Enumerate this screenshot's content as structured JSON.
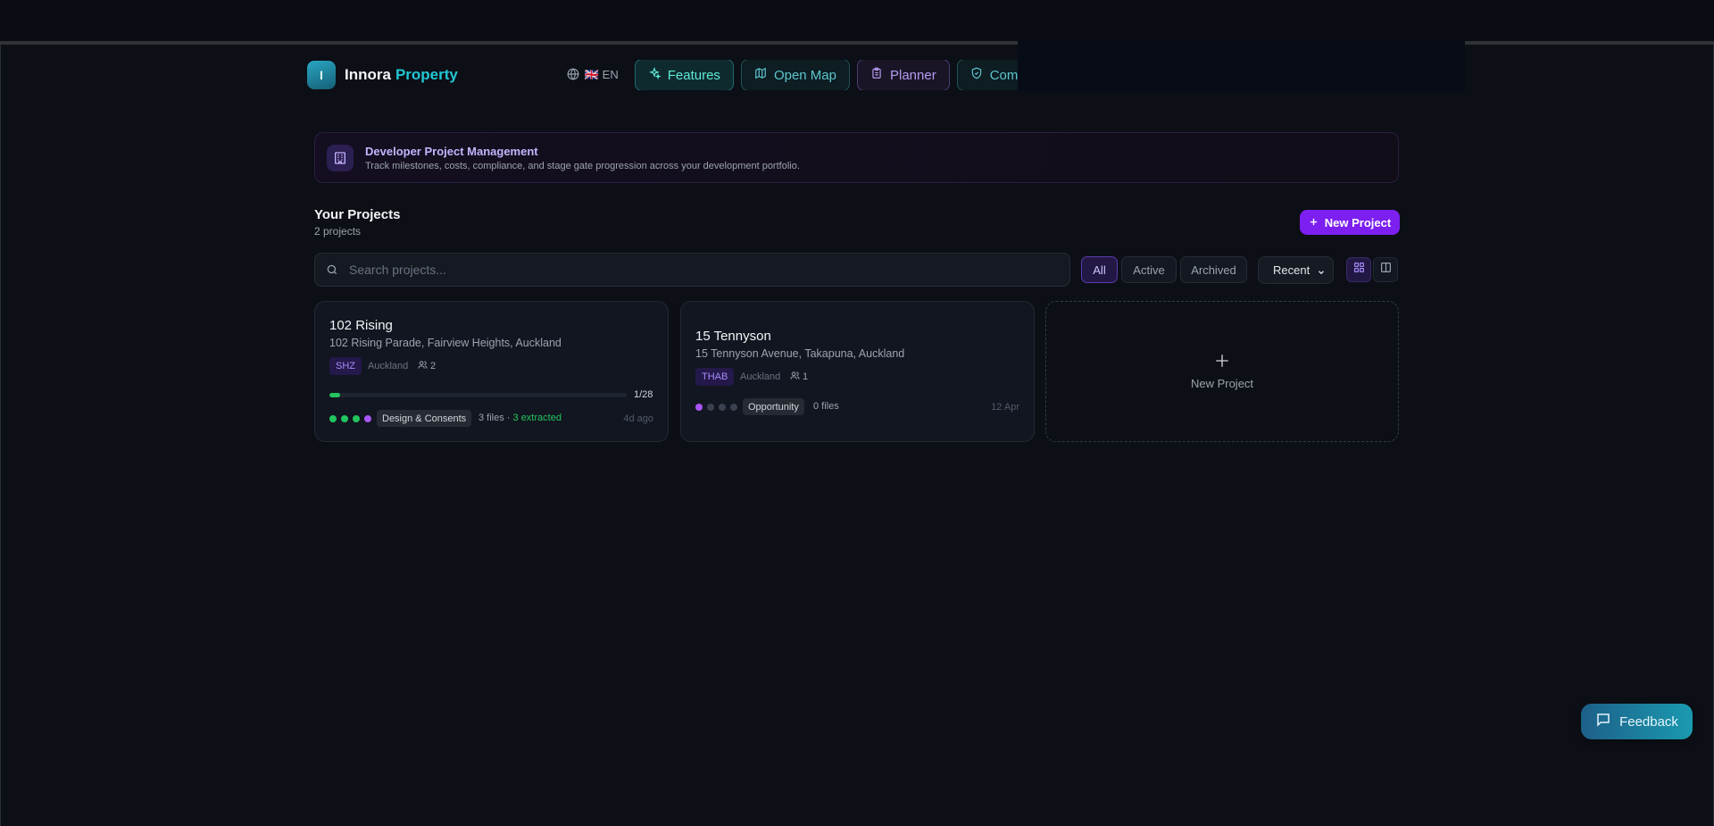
{
  "colors": {
    "brand_accent": "#22c7d3",
    "primary_purple": "#7c1ff0",
    "success_green": "#22c55e",
    "stage_purple": "#a855f7"
  },
  "nav": {
    "logo_letter": "I",
    "brand_first": "Innora",
    "brand_second": "Property",
    "lang_icon": "globe-icon",
    "lang_label": "🇬🇧 EN",
    "buttons": [
      {
        "label": "Features",
        "icon": "sparkles-icon"
      },
      {
        "label": "Open Map",
        "icon": "map-icon"
      },
      {
        "label": "Planner",
        "icon": "clipboard-icon"
      },
      {
        "label": "Complia",
        "icon": "shield-icon"
      }
    ]
  },
  "banner": {
    "icon": "building-icon",
    "title": "Developer Project Management",
    "subtitle": "Track milestones, costs, compliance, and stage gate progression across your development portfolio."
  },
  "projects_header": {
    "title": "Your Projects",
    "count": "2 projects",
    "new_button": "New Project"
  },
  "search": {
    "placeholder": "Search projects..."
  },
  "filters": {
    "all": "All",
    "active": "Active",
    "archived": "Archived",
    "selected": "All"
  },
  "sort": {
    "selected": "Recent"
  },
  "view": {
    "selected": "grid"
  },
  "projects": [
    {
      "name": "102 Rising",
      "address": "102 Rising Parade, Fairview Heights, Auckland",
      "zone": "SHZ",
      "city": "Auckland",
      "members": "2",
      "progress_label": "1/28",
      "progress_fraction": 0.0357,
      "stage": "Design & Consents",
      "files": "3 files · ",
      "extracted": "3 extracted",
      "date": "4d ago"
    },
    {
      "name": "15 Tennyson",
      "address": "15 Tennyson Avenue, Takapuna, Auckland",
      "zone": "THAB",
      "city": "Auckland",
      "members": "1",
      "stage": "Opportunity",
      "files": "0 files",
      "date": "12 Apr"
    }
  ],
  "new_card": {
    "label": "New Project"
  },
  "feedback": {
    "label": "Feedback",
    "icon": "message-icon"
  }
}
